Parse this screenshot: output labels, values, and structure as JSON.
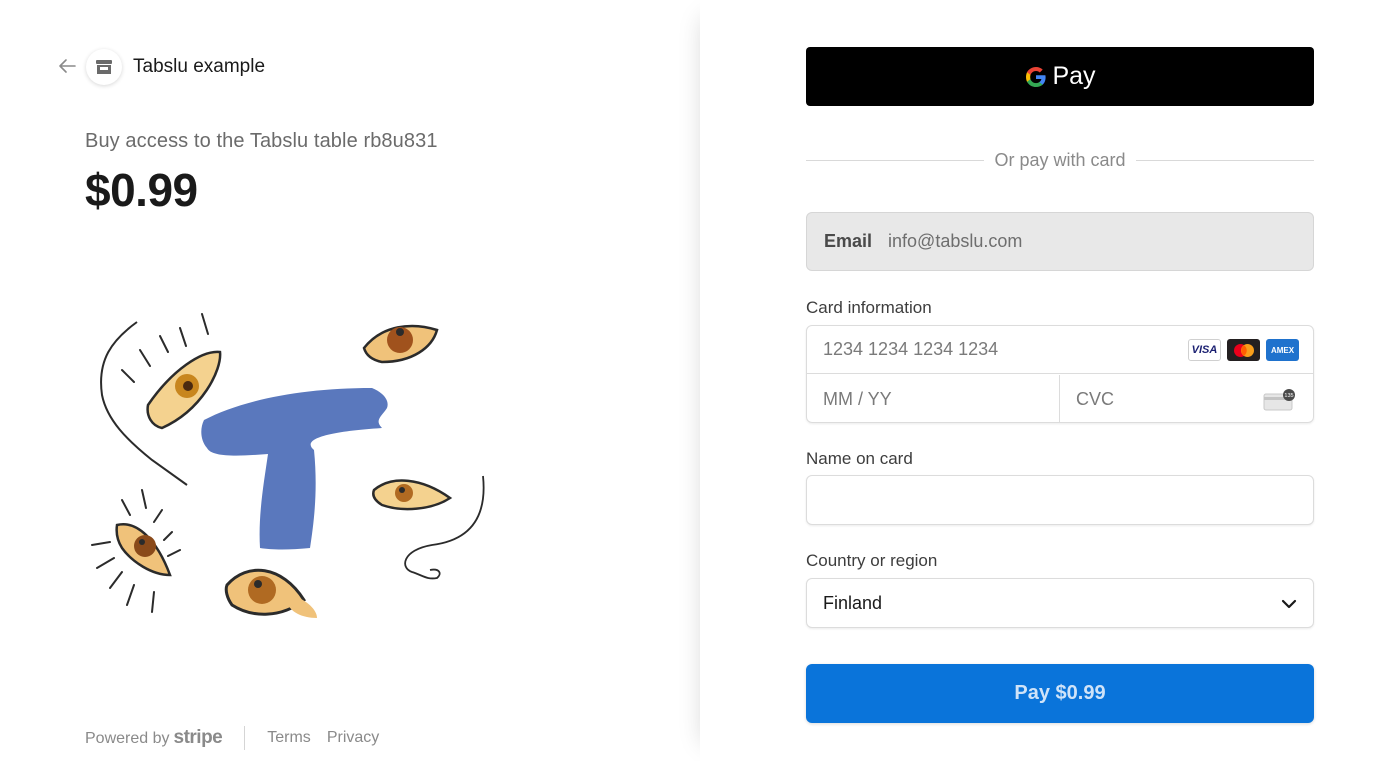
{
  "merchant": {
    "name": "Tabslu example"
  },
  "product": {
    "name": "Buy access to the Tabslu table rb8u831",
    "price": "$0.99"
  },
  "footer": {
    "powered_by": "Powered by",
    "brand": "stripe",
    "terms": "Terms",
    "privacy": "Privacy"
  },
  "payment": {
    "gpay_label": "Pay",
    "divider_text": "Or pay with card",
    "email_label": "Email",
    "email_value": "info@tabslu.com",
    "card_label": "Card information",
    "card_number_placeholder": "1234 1234 1234 1234",
    "expiry_placeholder": "MM / YY",
    "cvc_placeholder": "CVC",
    "card_brands": [
      "VISA",
      "mastercard",
      "AMEX"
    ],
    "name_label": "Name on card",
    "name_value": "",
    "country_label": "Country or region",
    "country_value": "Finland",
    "pay_button": "Pay $0.99"
  },
  "colors": {
    "pay_button": "#0a74da",
    "artwork_t": "#5a78bd",
    "eye_fill": "#f0c27a"
  },
  "icons": [
    "back-arrow-icon",
    "store-icon",
    "google-g-icon",
    "visa-icon",
    "mastercard-icon",
    "amex-icon",
    "cvc-card-icon",
    "chevron-down-icon"
  ]
}
